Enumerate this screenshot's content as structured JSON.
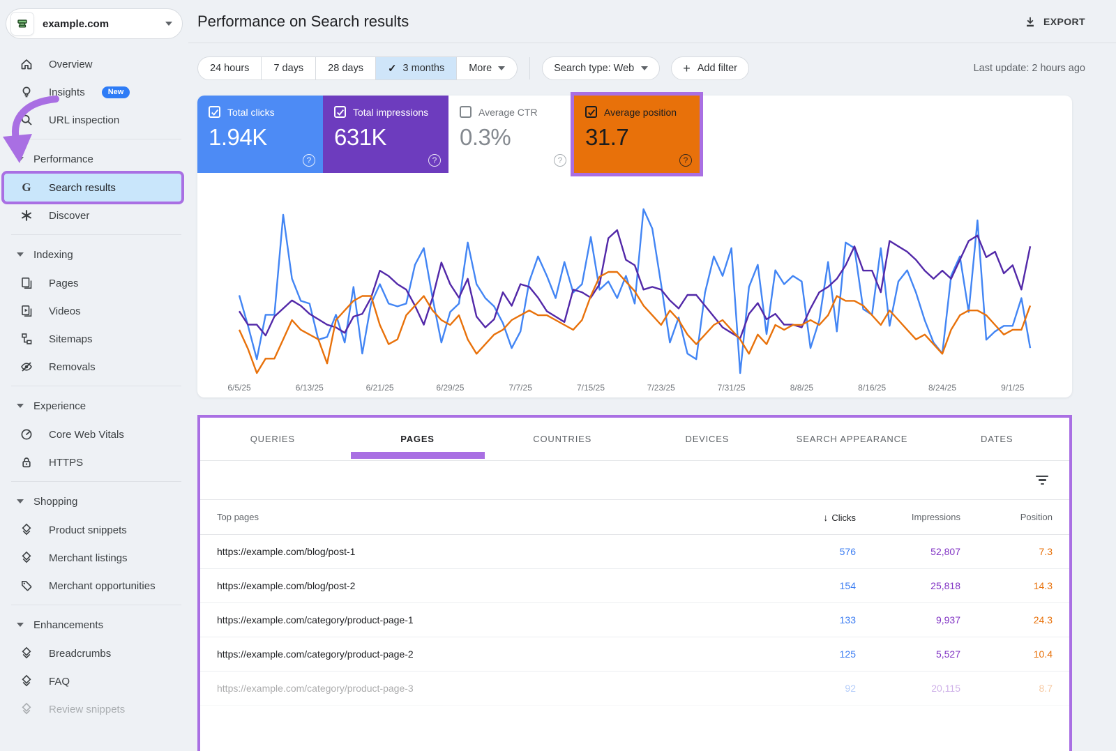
{
  "colors": {
    "page_bg": "#eef1f5",
    "annotation_purple": "#a96fe3",
    "active_nav_bg": "#c9e6fb",
    "selected_chip_bg": "#cfe5f9",
    "clicks_blue": "#4285f4",
    "impressions_purple_card": "#6d3cbe",
    "impressions_purple_line": "#5228a8",
    "impressions_purple_text": "#8133c4",
    "position_orange": "#e8710a"
  },
  "sidebar": {
    "property": {
      "name": "example.com"
    },
    "nav": [
      {
        "type": "item",
        "icon": "home",
        "label": "Overview"
      },
      {
        "type": "item",
        "icon": "lightbulb",
        "label": "Insights",
        "badge": "New"
      },
      {
        "type": "item",
        "icon": "search",
        "label": "URL inspection"
      },
      {
        "type": "divider"
      },
      {
        "type": "section",
        "label": "Performance"
      },
      {
        "type": "item",
        "icon": "google-g",
        "label": "Search results",
        "active": true
      },
      {
        "type": "item",
        "icon": "asterisk",
        "label": "Discover"
      },
      {
        "type": "divider"
      },
      {
        "type": "section",
        "label": "Indexing"
      },
      {
        "type": "item",
        "icon": "pages",
        "label": "Pages"
      },
      {
        "type": "item",
        "icon": "video",
        "label": "Videos"
      },
      {
        "type": "item",
        "icon": "sitemap",
        "label": "Sitemaps"
      },
      {
        "type": "item",
        "icon": "eye-off",
        "label": "Removals"
      },
      {
        "type": "divider"
      },
      {
        "type": "section",
        "label": "Experience"
      },
      {
        "type": "item",
        "icon": "gauge",
        "label": "Core Web Vitals"
      },
      {
        "type": "item",
        "icon": "lock",
        "label": "HTTPS"
      },
      {
        "type": "divider"
      },
      {
        "type": "section",
        "label": "Shopping"
      },
      {
        "type": "item",
        "icon": "rich-result",
        "label": "Product snippets"
      },
      {
        "type": "item",
        "icon": "rich-result",
        "label": "Merchant listings"
      },
      {
        "type": "item",
        "icon": "tag",
        "label": "Merchant opportunities"
      },
      {
        "type": "divider"
      },
      {
        "type": "section",
        "label": "Enhancements"
      },
      {
        "type": "item",
        "icon": "rich-result",
        "label": "Breadcrumbs"
      },
      {
        "type": "item",
        "icon": "rich-result",
        "label": "FAQ"
      },
      {
        "type": "item",
        "icon": "rich-result",
        "label": "Review snippets",
        "faded": true
      }
    ]
  },
  "header": {
    "title": "Performance on Search results",
    "export_label": "EXPORT"
  },
  "filters": {
    "ranges": [
      {
        "label": "24 hours"
      },
      {
        "label": "7 days"
      },
      {
        "label": "28 days"
      },
      {
        "label": "3 months",
        "selected": true
      },
      {
        "label": "More",
        "caret": true
      }
    ],
    "search_type": "Search type: Web",
    "add_filter": "Add filter",
    "last_update": "Last update: 2 hours ago"
  },
  "cards": [
    {
      "label": "Total clicks",
      "value": "1.94K",
      "checked": true,
      "bg": "#4d8bf5",
      "fg": "#ffffff",
      "value_fg": "#ffffff"
    },
    {
      "label": "Total impressions",
      "value": "631K",
      "checked": true,
      "bg": "#6d3cbe",
      "fg": "#ffffff",
      "value_fg": "#ffffff"
    },
    {
      "label": "Average CTR",
      "value": "0.3%",
      "checked": false,
      "bg": "#ffffff",
      "fg": "#6f7378",
      "value_fg": "#84898f"
    },
    {
      "label": "Average position",
      "value": "31.7",
      "checked": true,
      "bg": "#e8710a",
      "fg": "#1b1c1e",
      "value_fg": "#1b1c1e",
      "highlighted": true
    }
  ],
  "chart_data": {
    "type": "line",
    "title": "",
    "xlabel": "",
    "ylabel": "",
    "grid": false,
    "legend_position": "none",
    "x": [
      "6/5/25",
      "6/6/25",
      "6/7/25",
      "6/8/25",
      "6/9/25",
      "6/10/25",
      "6/11/25",
      "6/12/25",
      "6/13/25",
      "6/14/25",
      "6/15/25",
      "6/16/25",
      "6/17/25",
      "6/18/25",
      "6/19/25",
      "6/20/25",
      "6/21/25",
      "6/22/25",
      "6/23/25",
      "6/24/25",
      "6/25/25",
      "6/26/25",
      "6/27/25",
      "6/28/25",
      "6/29/25",
      "6/30/25",
      "7/1/25",
      "7/2/25",
      "7/3/25",
      "7/4/25",
      "7/5/25",
      "7/6/25",
      "7/7/25",
      "7/8/25",
      "7/9/25",
      "7/10/25",
      "7/11/25",
      "7/12/25",
      "7/13/25",
      "7/14/25",
      "7/15/25",
      "7/16/25",
      "7/17/25",
      "7/18/25",
      "7/19/25",
      "7/20/25",
      "7/21/25",
      "7/22/25",
      "7/23/25",
      "7/24/25",
      "7/25/25",
      "7/26/25",
      "7/27/25",
      "7/28/25",
      "7/29/25",
      "7/30/25",
      "7/31/25",
      "8/1/25",
      "8/2/25",
      "8/3/25",
      "8/4/25",
      "8/5/25",
      "8/6/25",
      "8/7/25",
      "8/8/25",
      "8/9/25",
      "8/10/25",
      "8/11/25",
      "8/12/25",
      "8/13/25",
      "8/14/25",
      "8/15/25",
      "8/16/25",
      "8/17/25",
      "8/18/25",
      "8/19/25",
      "8/20/25",
      "8/21/25",
      "8/22/25",
      "8/23/25",
      "8/24/25",
      "8/25/25",
      "8/26/25",
      "8/27/25",
      "8/28/25",
      "8/29/25",
      "8/30/25",
      "8/31/25",
      "9/1/25",
      "9/2/25",
      "9/3/25"
    ],
    "tick_indices": [
      0,
      8,
      16,
      24,
      32,
      40,
      48,
      56,
      64,
      72,
      80,
      88
    ],
    "series": [
      {
        "name": "Total clicks",
        "key": "clicks",
        "color": "#4285f4",
        "values": [
          31,
          20,
          8,
          24,
          24,
          60,
          37,
          29,
          28,
          15,
          16,
          24,
          14,
          34,
          10,
          28,
          35,
          28,
          27,
          28,
          42,
          48,
          30,
          14,
          25,
          28,
          50,
          35,
          30,
          27,
          21,
          12,
          18,
          36,
          45,
          38,
          30,
          43,
          32,
          35,
          52,
          33,
          36,
          30,
          38,
          28,
          62,
          55,
          35,
          14,
          23,
          10,
          8,
          32,
          45,
          38,
          48,
          3,
          34,
          42,
          17,
          40,
          35,
          38,
          36,
          12,
          22,
          43,
          18,
          50,
          48,
          26,
          24,
          48,
          20,
          36,
          40,
          32,
          22,
          14,
          10,
          38,
          45,
          25,
          58,
          15,
          18,
          20,
          20,
          30,
          12
        ]
      },
      {
        "name": "Total impressions",
        "key": "impressions",
        "color": "#5228a8",
        "values": [
          6800,
          6300,
          6300,
          5900,
          6600,
          6900,
          7200,
          7000,
          6700,
          6500,
          6300,
          6200,
          6000,
          6600,
          6700,
          7300,
          8300,
          8100,
          7800,
          7600,
          7000,
          6300,
          7300,
          8600,
          7800,
          7300,
          8000,
          6600,
          6200,
          6500,
          7500,
          7000,
          7800,
          7700,
          7300,
          6800,
          6600,
          6400,
          7600,
          7500,
          7300,
          7800,
          9500,
          9800,
          8700,
          8500,
          7600,
          7700,
          7600,
          7200,
          6900,
          7400,
          7400,
          7000,
          6600,
          6200,
          6000,
          5800,
          6700,
          7100,
          6500,
          6700,
          6300,
          6300,
          6200,
          6900,
          7500,
          7700,
          8000,
          8500,
          9200,
          8300,
          8300,
          7500,
          9400,
          9200,
          9000,
          8700,
          8300,
          8000,
          8300,
          8000,
          8700,
          9400,
          9600,
          8800,
          9000,
          8200,
          8500,
          7600,
          9200
        ]
      },
      {
        "name": "Average position",
        "key": "position",
        "color": "#e8710a",
        "axis_inverted": true,
        "values": [
          35,
          39,
          44,
          41,
          41,
          37,
          33,
          35,
          36,
          37,
          42,
          33,
          31,
          29,
          28,
          28,
          34,
          38,
          37,
          32,
          30,
          28,
          31,
          33,
          34,
          32,
          37,
          40,
          38,
          36,
          35,
          33,
          32,
          31,
          32,
          32,
          33,
          34,
          35,
          33,
          28,
          24,
          23,
          23,
          25,
          27,
          30,
          32,
          34,
          31,
          33,
          36,
          38,
          36,
          34,
          33,
          35,
          37,
          40,
          36,
          38,
          34,
          35,
          34,
          34,
          33,
          34,
          32,
          28,
          29,
          29,
          30,
          32,
          34,
          31,
          33,
          35,
          37,
          36,
          38,
          40,
          35,
          32,
          31,
          31,
          32,
          34,
          36,
          35,
          35,
          30
        ]
      }
    ]
  },
  "tabs": {
    "items": [
      {
        "label": "QUERIES"
      },
      {
        "label": "PAGES",
        "active": true
      },
      {
        "label": "COUNTRIES"
      },
      {
        "label": "DEVICES"
      },
      {
        "label": "SEARCH APPEARANCE"
      },
      {
        "label": "DATES"
      }
    ]
  },
  "table": {
    "headers": {
      "url": "Top pages",
      "clicks": "Clicks",
      "impressions": "Impressions",
      "position": "Position"
    },
    "sort_column": "clicks",
    "rows": [
      {
        "url": "https://example.com/blog/post-1",
        "clicks": "576",
        "impressions": "52,807",
        "position": "7.3"
      },
      {
        "url": "https://example.com/blog/post-2",
        "clicks": "154",
        "impressions": "25,818",
        "position": "14.3"
      },
      {
        "url": "https://example.com/category/product-page-1",
        "clicks": "133",
        "impressions": "9,937",
        "position": "24.3"
      },
      {
        "url": "https://example.com/category/product-page-2",
        "clicks": "125",
        "impressions": "5,527",
        "position": "10.4"
      },
      {
        "url": "https://example.com/category/product-page-3",
        "clicks": "92",
        "impressions": "20,115",
        "position": "8.7",
        "faded": true
      }
    ]
  }
}
